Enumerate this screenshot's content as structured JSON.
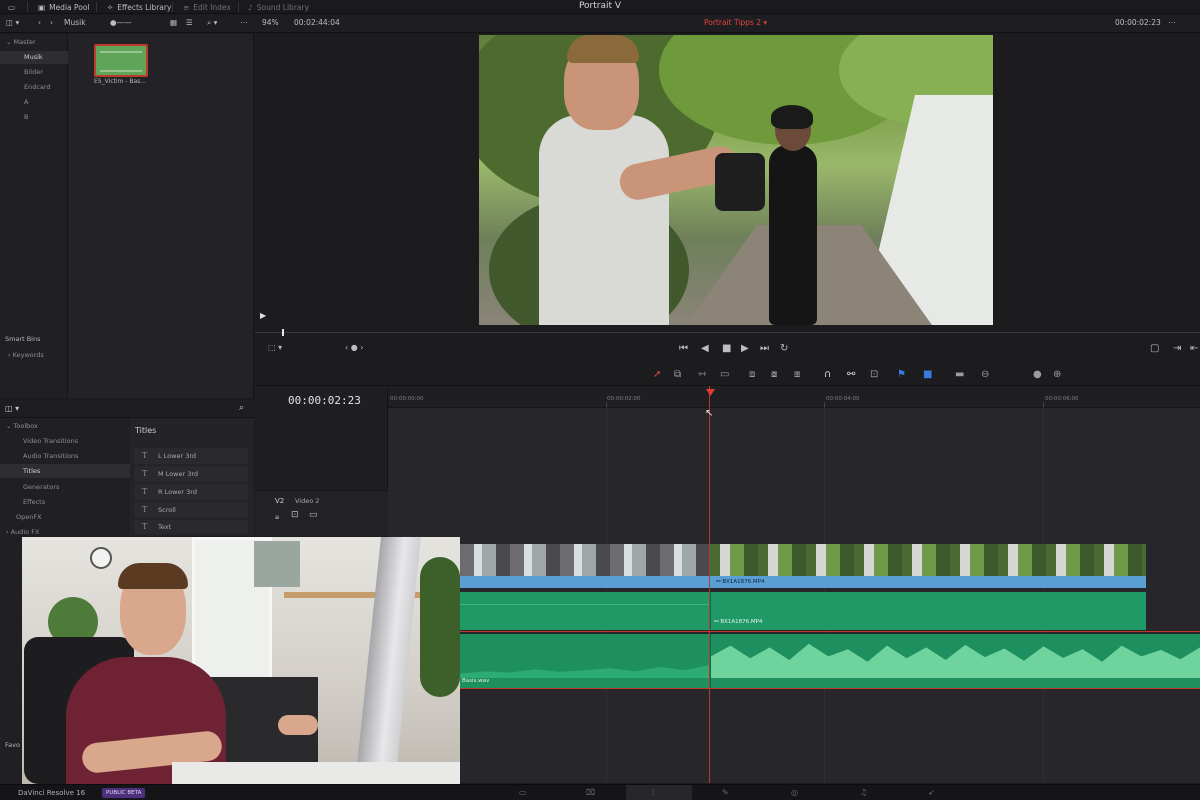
{
  "topbar": {
    "items": [
      {
        "label": "Media Pool",
        "icon": "media-pool-icon"
      },
      {
        "label": "Effects Library",
        "icon": "effects-icon"
      },
      {
        "label": "Edit Index",
        "icon": "index-icon"
      },
      {
        "label": "Sound Library",
        "icon": "sound-icon"
      }
    ],
    "project_title": "Portrait V"
  },
  "bar2": {
    "bin": "Musik",
    "zoom": "94%",
    "duration": "00:02:44:04",
    "timeline_name": "Portrait Tipps 2",
    "timecode": "00:00:02:23"
  },
  "media_pool": {
    "master": "Master",
    "bins": [
      "Musik",
      "Bilder",
      "Endcard",
      "A",
      "B"
    ],
    "active_bin": "Musik",
    "clip_name": "ES_Victim - Bas...",
    "smart_bins": "Smart Bins",
    "keywords": "Keywords"
  },
  "effects": {
    "tree": [
      "Toolbox",
      "Video Transitions",
      "Audio Transitions",
      "Titles",
      "Generators",
      "Effects",
      "OpenFX",
      "Audio FX"
    ],
    "active": "Titles",
    "list_header": "Titles",
    "titles": [
      "L Lower 3rd",
      "M Lower 3rd",
      "R Lower 3rd",
      "Scroll",
      "Text"
    ],
    "favorites": "Favo"
  },
  "timeline": {
    "timecode": "00:00:02:23",
    "ruler": [
      "00:00:00:00",
      "00:00:02:00",
      "00:00:04:00",
      "00:00:06:00"
    ],
    "track_label": "V2",
    "track_name": "Video 2",
    "video_clip": "BX1A1876.MP4",
    "audio_clip_1": "BX1A1876.MP4",
    "audio_clip_2": "Basis.wav"
  },
  "bottombar": {
    "app_name": "DaVinci Resolve 16",
    "badge": "PUBLIC BETA"
  },
  "colors": {
    "accent_red": "#e53a30",
    "clip_blue": "#5a9fd4",
    "audio_green": "#1f9a66"
  }
}
